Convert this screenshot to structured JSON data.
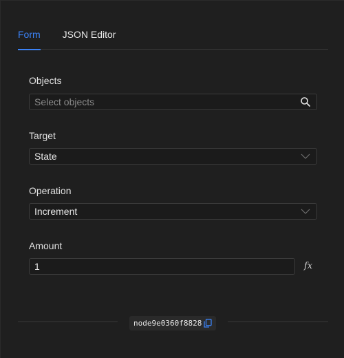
{
  "tabs": [
    {
      "label": "Form",
      "active": true
    },
    {
      "label": "JSON Editor",
      "active": false
    }
  ],
  "fields": {
    "objects": {
      "label": "Objects",
      "placeholder": "Select objects",
      "icon": "search-icon"
    },
    "target": {
      "label": "Target",
      "value": "State",
      "icon": "chevron-down-icon"
    },
    "operation": {
      "label": "Operation",
      "value": "Increment",
      "icon": "chevron-down-icon"
    },
    "amount": {
      "label": "Amount",
      "value": "1",
      "fx_label": "fx"
    }
  },
  "footer": {
    "node_id": "node9e0360f8828",
    "icon": "copy-icon"
  },
  "colors": {
    "accent": "#3b82f6",
    "background": "#1f1f1f"
  }
}
